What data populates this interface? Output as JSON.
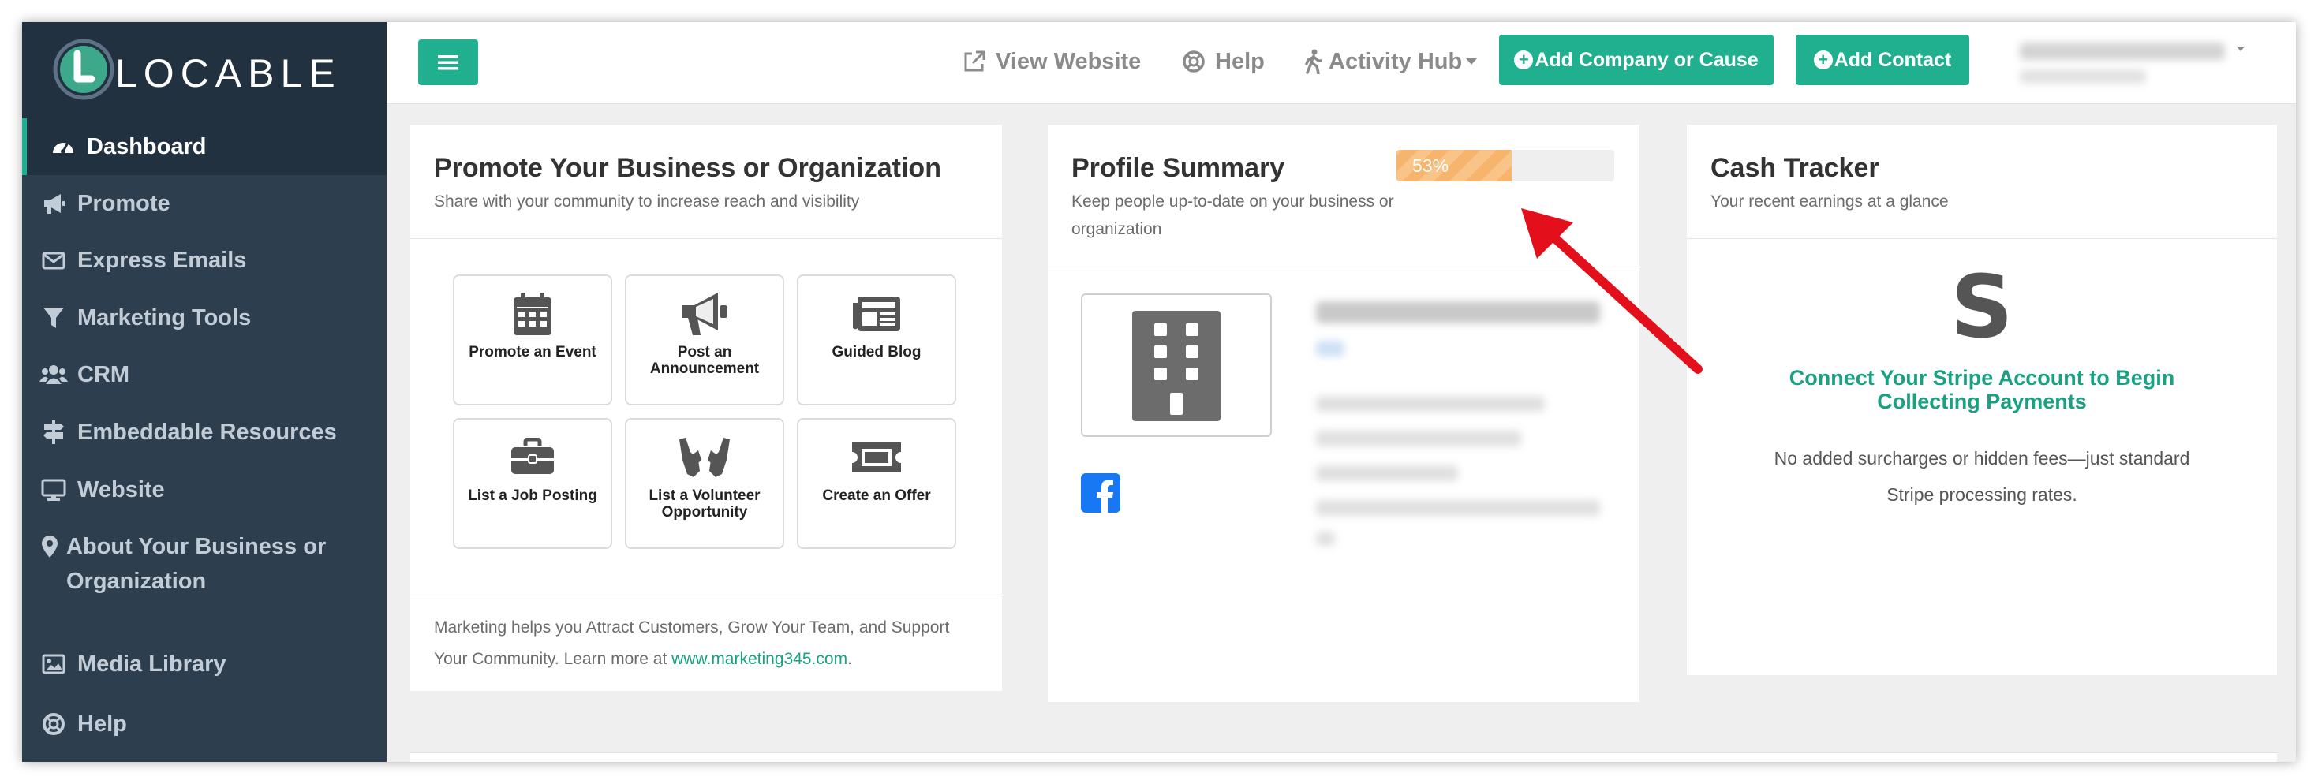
{
  "brand": {
    "name": "LOCABLE"
  },
  "colors": {
    "accent": "#20b08f",
    "sidebar": "#2d3e4f",
    "progress": "#f6b46d",
    "arrow": "#e3101b"
  },
  "sidebar": {
    "items": [
      {
        "label": "Dashboard",
        "icon": "gauge-icon",
        "active": true
      },
      {
        "label": "Promote",
        "icon": "megaphone-icon"
      },
      {
        "label": "Express Emails",
        "icon": "envelope-icon"
      },
      {
        "label": "Marketing Tools",
        "icon": "filter-icon"
      },
      {
        "label": "CRM",
        "icon": "users-icon"
      },
      {
        "label": "Embeddable Resources",
        "icon": "signpost-icon"
      },
      {
        "label": "Website",
        "icon": "monitor-icon"
      },
      {
        "label": "About Your Business or Organization",
        "icon": "map-pin-icon"
      },
      {
        "label": "Media Library",
        "icon": "image-icon"
      },
      {
        "label": "Help",
        "icon": "lifebuoy-icon"
      }
    ]
  },
  "topbar": {
    "view_website": "View Website",
    "help": "Help",
    "activity_hub": "Activity Hub",
    "add_company": "Add Company or Cause",
    "add_contact": "Add Contact"
  },
  "promote_card": {
    "title": "Promote Your Business or Organization",
    "subtitle": "Share with your community to increase reach and visibility",
    "tiles": [
      {
        "label": "Promote an Event",
        "icon": "calendar-icon"
      },
      {
        "label": "Post an Announcement",
        "icon": "megaphone-icon"
      },
      {
        "label": "Guided Blog",
        "icon": "newspaper-icon"
      },
      {
        "label": "List a Job Posting",
        "icon": "briefcase-icon"
      },
      {
        "label": "List a Volunteer Opportunity",
        "icon": "helping-hands-icon"
      },
      {
        "label": "Create an Offer",
        "icon": "ticket-icon"
      }
    ],
    "footer_text": "Marketing helps you Attract Customers, Grow Your Team, and Support Your Community. Learn more at ",
    "footer_link": "www.marketing345.com",
    "footer_end": "."
  },
  "profile_card": {
    "title": "Profile Summary",
    "subtitle": "Keep people up-to-date on your business or organization",
    "progress_percent": 53,
    "progress_label": "53%"
  },
  "cash_card": {
    "title": "Cash Tracker",
    "subtitle": "Your recent earnings at a glance",
    "stripe_glyph": "S",
    "connect_text": "Connect Your Stripe Account to Begin Collecting Payments",
    "fees_text": "No added surcharges or hidden fees—just standard Stripe processing rates."
  }
}
